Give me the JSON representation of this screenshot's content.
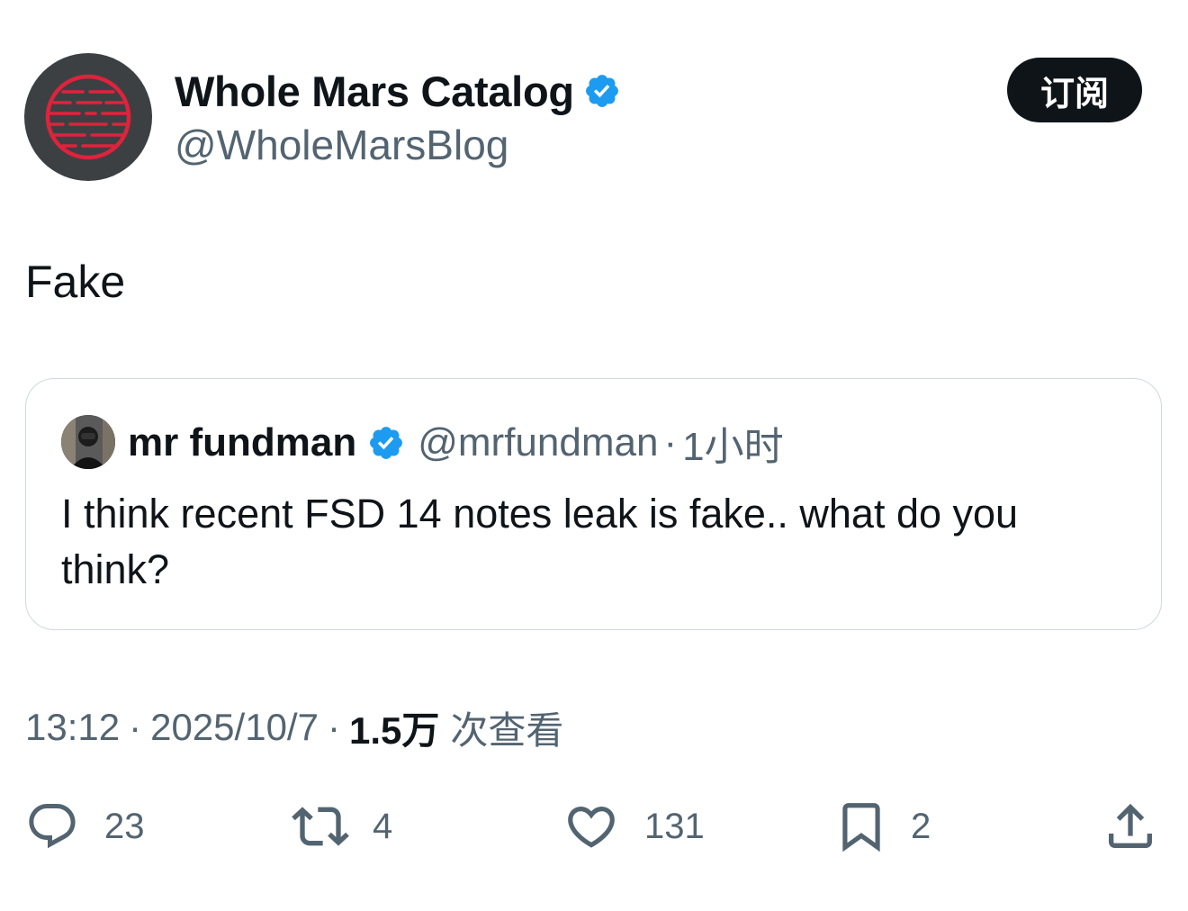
{
  "author": {
    "display_name": "Whole Mars Catalog",
    "handle": "@WholeMarsBlog",
    "avatar_icon": "mars-logo-icon",
    "verified": true
  },
  "subscribe_label": "订阅",
  "tweet": {
    "text": "Fake"
  },
  "quoted": {
    "display_name": "mr fundman",
    "handle": "@mrfundman",
    "separator": "·",
    "time_ago": "1小时",
    "text": "I think recent FSD 14 notes leak is fake.. what do you think?"
  },
  "meta": {
    "time": "13:12",
    "sep1": "·",
    "date": "2025/10/7",
    "sep2": "·",
    "views": "1.5万",
    "views_label": "次查看"
  },
  "actions": {
    "reply_count": "23",
    "repost_count": "4",
    "like_count": "131",
    "bookmark_count": "2"
  },
  "colors": {
    "text_primary": "#0f1419",
    "text_secondary": "#536471",
    "verified_blue": "#1d9bf0",
    "border": "#cfd9de",
    "logo_red": "#e0223c"
  }
}
